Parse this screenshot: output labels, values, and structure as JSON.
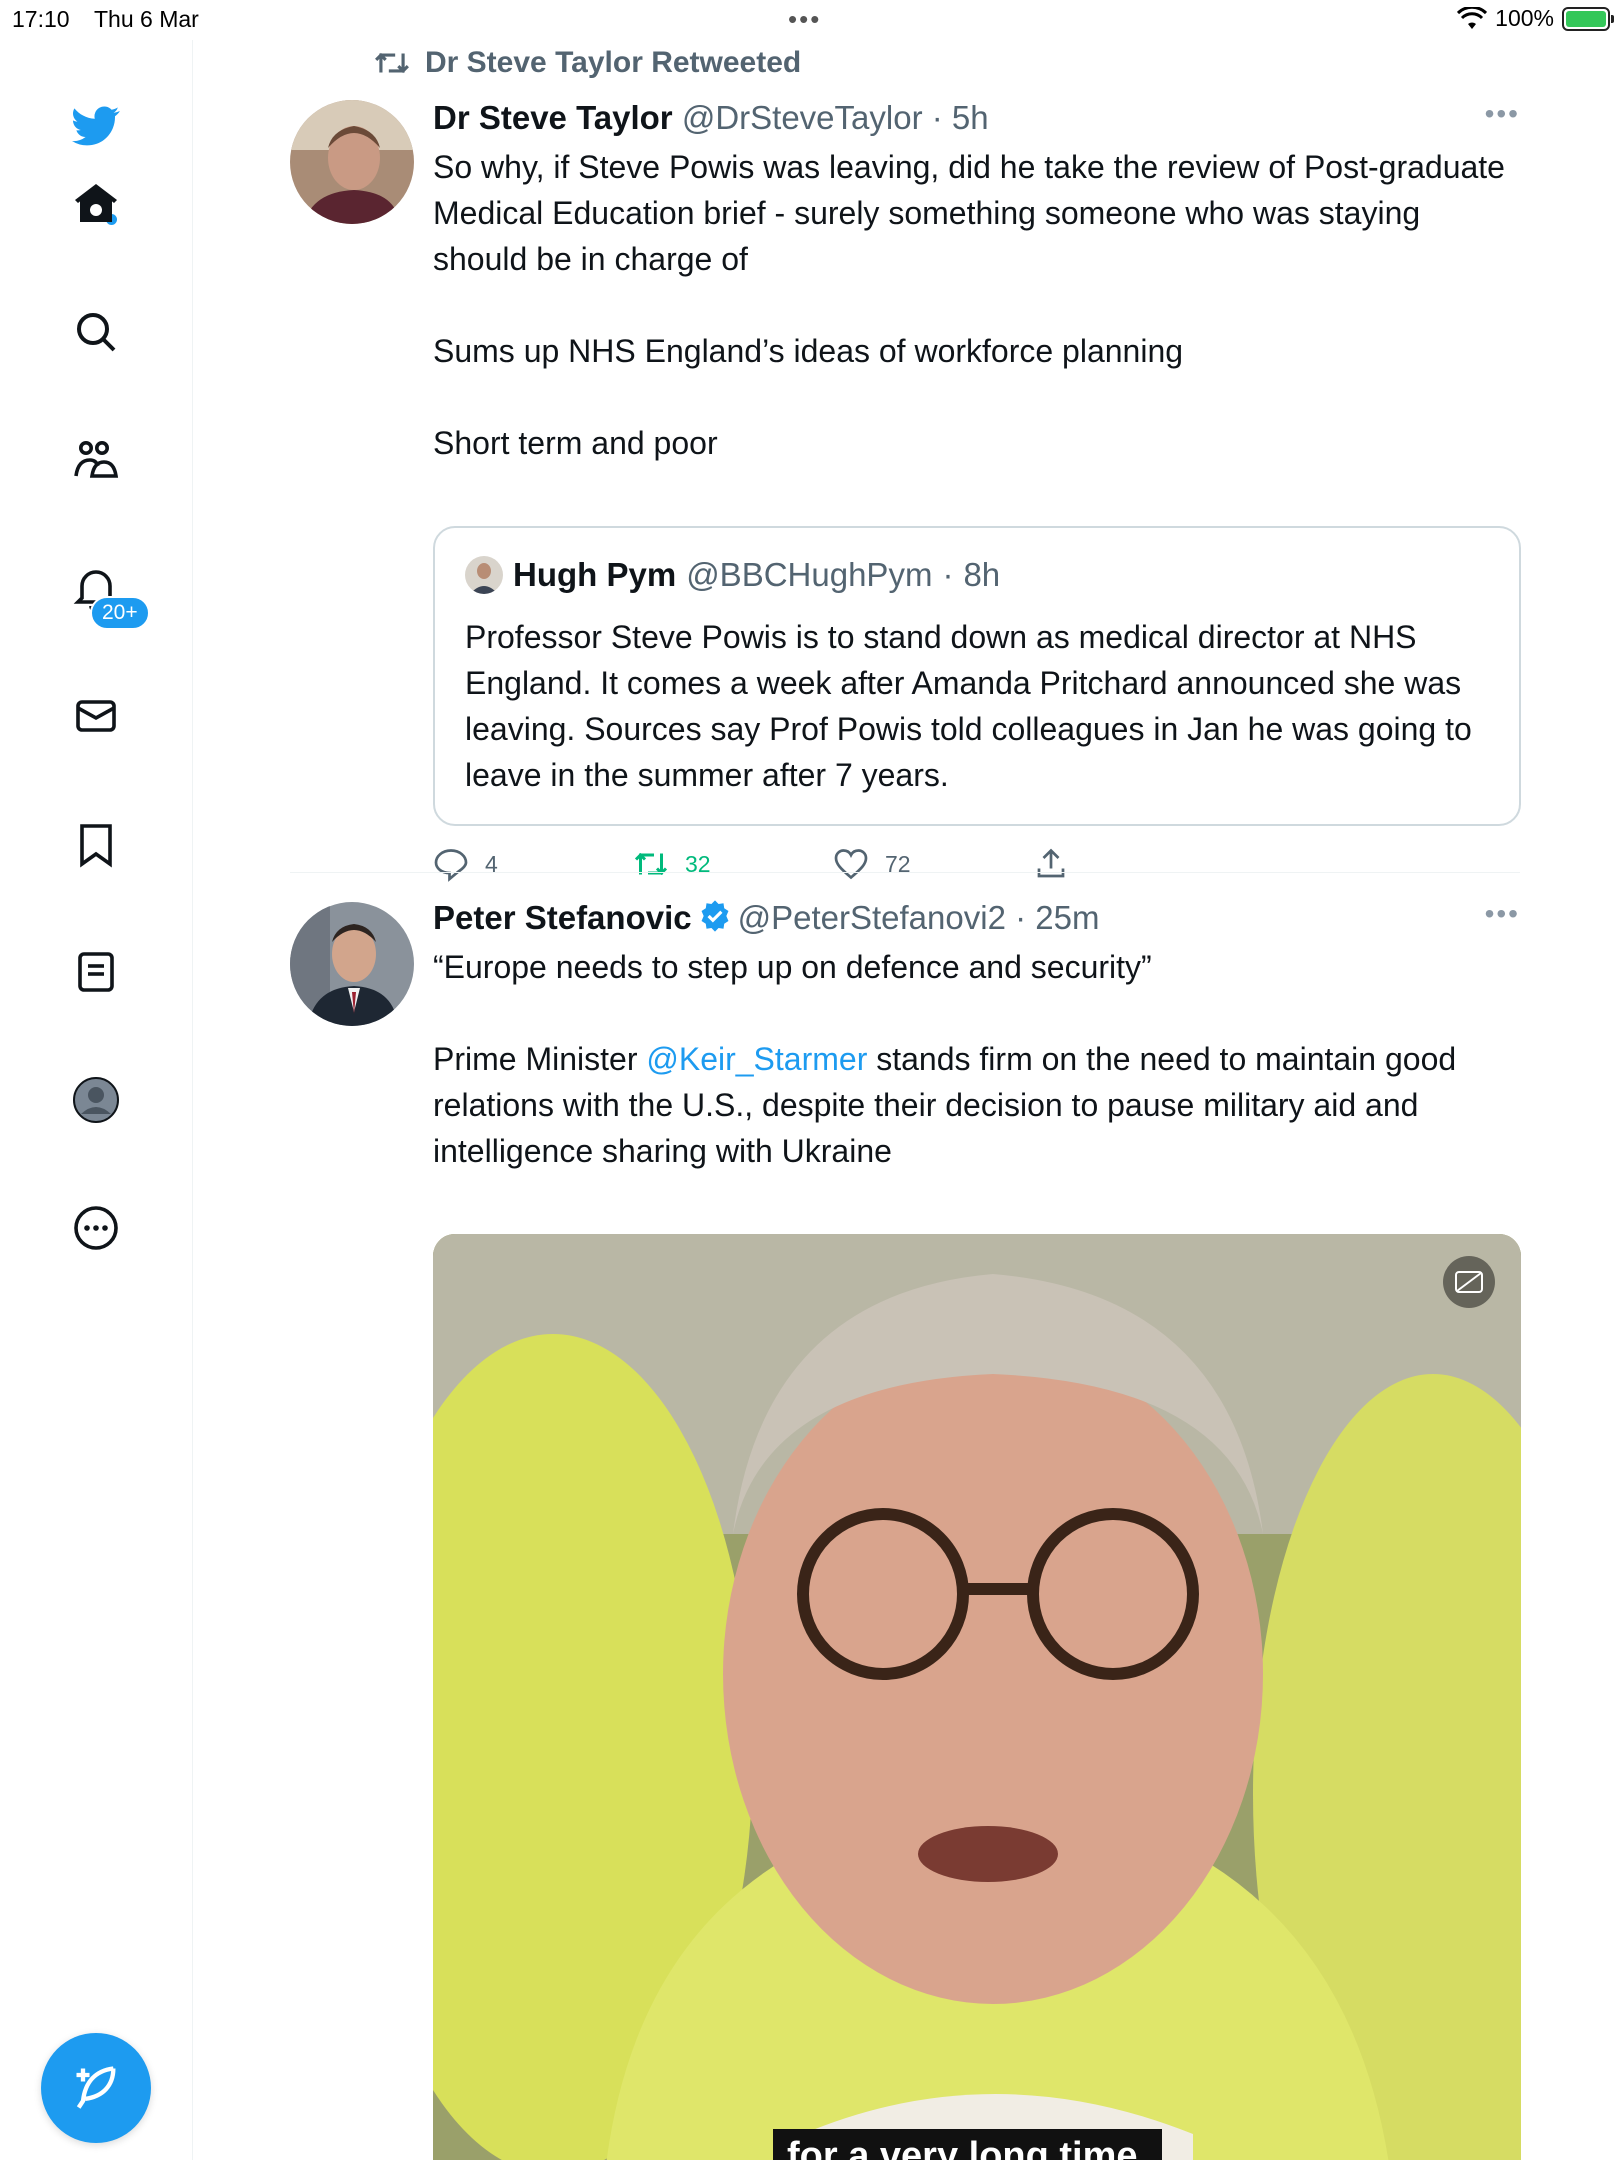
{
  "status_bar": {
    "time": "17:10",
    "date": "Thu 6 Mar",
    "battery": "100%"
  },
  "sidebar": {
    "notifications_badge": "20+"
  },
  "tweet1": {
    "retweet_label": "Dr Steve Taylor Retweeted",
    "name": "Dr Steve Taylor",
    "handle": "@DrSteveTaylor",
    "time": "5h",
    "text": "So why, if Steve Powis was leaving, did he take the review of Post-graduate Medical Education brief - surely something someone who was staying should be in charge of\n\nSums up NHS England’s ideas of workforce planning\n\nShort term and poor",
    "quote": {
      "name": "Hugh Pym",
      "handle": "@BBCHughPym",
      "time": "8h",
      "text": "Professor Steve Powis is to stand down as medical director at NHS England. It comes a week after Amanda Pritchard announced she was leaving. Sources say Prof Powis told colleagues in Jan he was going to leave in the summer after 7 years."
    },
    "replies": "4",
    "retweets": "32",
    "likes": "72"
  },
  "tweet2": {
    "name": "Peter Stefanovic",
    "handle": "@PeterStefanovi2",
    "time": "25m",
    "text_line1": "“Europe needs to step up on defence and security”",
    "text_prefix": "Prime Minister ",
    "mention": "@Keir_Starmer",
    "text_suffix": " stands firm on the need to maintain good relations with the U.S., despite their decision to pause military aid and intelligence sharing with Ukraine",
    "video_caption": "for a very long time."
  }
}
